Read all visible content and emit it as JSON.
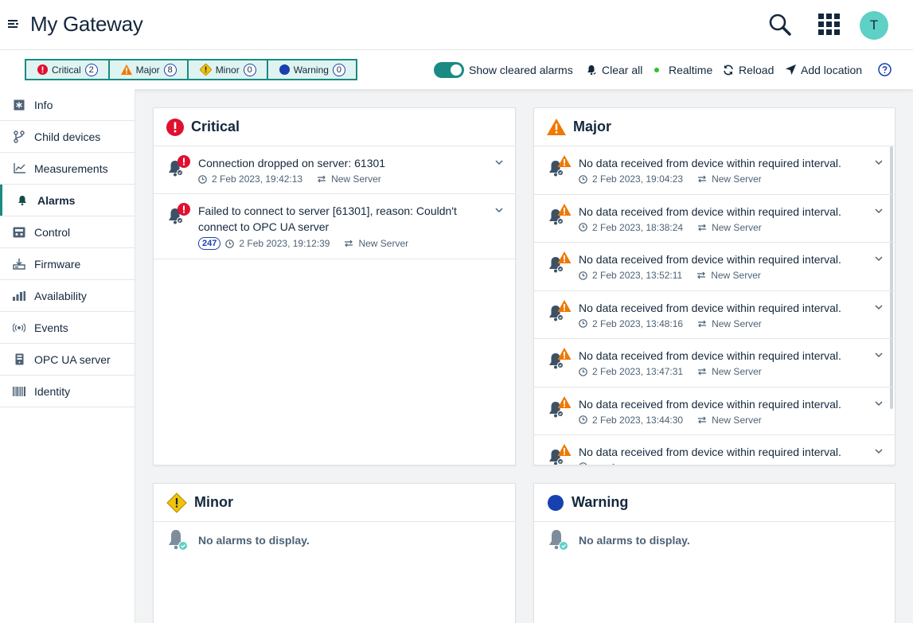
{
  "app": {
    "title": "My Gateway",
    "avatar_initial": "T"
  },
  "filters": [
    {
      "label": "Critical",
      "count": "2",
      "icon": "critical-icon"
    },
    {
      "label": "Major",
      "count": "8",
      "icon": "major-icon"
    },
    {
      "label": "Minor",
      "count": "0",
      "icon": "minor-icon"
    },
    {
      "label": "Warning",
      "count": "0",
      "icon": "warning-icon"
    }
  ],
  "actions": {
    "show_cleared": "Show cleared alarms",
    "clear_all": "Clear all",
    "realtime": "Realtime",
    "reload": "Reload",
    "add_location": "Add location"
  },
  "sidebar": {
    "items": [
      {
        "label": "Info",
        "icon": "info-icon"
      },
      {
        "label": "Child devices",
        "icon": "child-devices-icon"
      },
      {
        "label": "Measurements",
        "icon": "chart-icon"
      },
      {
        "label": "Alarms",
        "icon": "bell-icon",
        "active": true
      },
      {
        "label": "Control",
        "icon": "control-icon"
      },
      {
        "label": "Firmware",
        "icon": "firmware-icon"
      },
      {
        "label": "Availability",
        "icon": "availability-icon"
      },
      {
        "label": "Events",
        "icon": "events-icon"
      },
      {
        "label": "OPC UA server",
        "icon": "server-icon"
      },
      {
        "label": "Identity",
        "icon": "barcode-icon"
      }
    ]
  },
  "cards": {
    "critical": {
      "title": "Critical",
      "alarms": [
        {
          "message": "Connection dropped on server: 61301",
          "time": "2 Feb 2023, 19:42:13",
          "source": "New Server"
        },
        {
          "message": "Failed to connect to server [61301], reason: Couldn't connect to OPC UA server",
          "count": "247",
          "time": "2 Feb 2023, 19:12:39",
          "source": "New Server"
        }
      ]
    },
    "major": {
      "title": "Major",
      "alarms": [
        {
          "message": "No data received from device within required interval.",
          "time": "2 Feb 2023, 19:04:23",
          "source": "New Server"
        },
        {
          "message": "No data received from device within required interval.",
          "time": "2 Feb 2023, 18:38:24",
          "source": "New Server"
        },
        {
          "message": "No data received from device within required interval.",
          "time": "2 Feb 2023, 13:52:11",
          "source": "New Server"
        },
        {
          "message": "No data received from device within required interval.",
          "time": "2 Feb 2023, 13:48:16",
          "source": "New Server"
        },
        {
          "message": "No data received from device within required interval.",
          "time": "2 Feb 2023, 13:47:31",
          "source": "New Server"
        },
        {
          "message": "No data received from device within required interval.",
          "time": "2 Feb 2023, 13:44:30",
          "source": "New Server"
        },
        {
          "message": "No data received from device within required interval.",
          "time": "",
          "source": ""
        }
      ]
    },
    "minor": {
      "title": "Minor",
      "empty": "No alarms to display."
    },
    "warning": {
      "title": "Warning",
      "empty": "No alarms to display."
    }
  },
  "colors": {
    "accent": "#1a8b83",
    "critical": "#e0102f",
    "major": "#f07800",
    "minor": "#f2c30c",
    "warning": "#1740b0"
  }
}
